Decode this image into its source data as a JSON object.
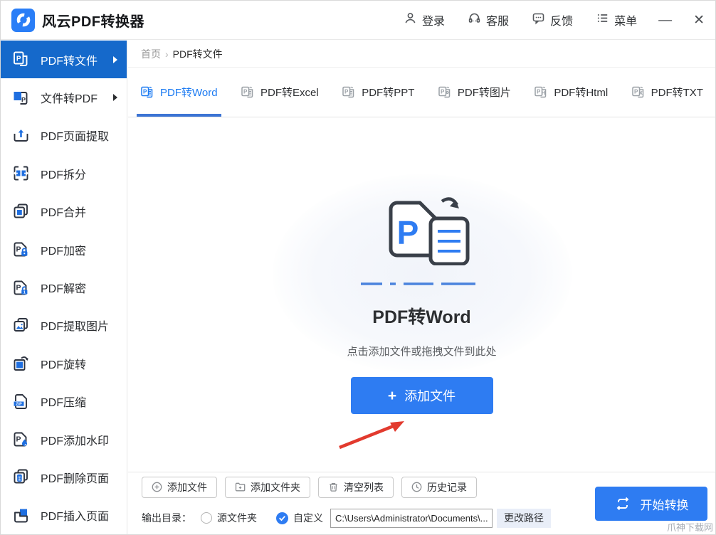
{
  "app": {
    "title": "风云PDF转换器",
    "topbar": {
      "login": "登录",
      "support": "客服",
      "feedback": "反馈",
      "menu": "菜单",
      "minimize": "—",
      "close": "✕"
    }
  },
  "sidebar": {
    "items": [
      {
        "label": "PDF转文件",
        "active": true
      },
      {
        "label": "文件转PDF"
      },
      {
        "label": "PDF页面提取"
      },
      {
        "label": "PDF拆分"
      },
      {
        "label": "PDF合并"
      },
      {
        "label": "PDF加密"
      },
      {
        "label": "PDF解密"
      },
      {
        "label": "PDF提取图片"
      },
      {
        "label": "PDF旋转"
      },
      {
        "label": "PDF压缩"
      },
      {
        "label": "PDF添加水印"
      },
      {
        "label": "PDF删除页面"
      },
      {
        "label": "PDF插入页面"
      }
    ]
  },
  "breadcrumb": {
    "home": "首页",
    "separator": "›",
    "current": "PDF转文件"
  },
  "tabs": [
    {
      "label": "PDF转Word",
      "active": true
    },
    {
      "label": "PDF转Excel"
    },
    {
      "label": "PDF转PPT"
    },
    {
      "label": "PDF转图片"
    },
    {
      "label": "PDF转Html"
    },
    {
      "label": "PDF转TXT"
    }
  ],
  "dropzone": {
    "title": "PDF转Word",
    "hint": "点击添加文件或拖拽文件到此处",
    "add_button_plus": "+",
    "add_button": "添加文件"
  },
  "toolbar": {
    "add_file": "添加文件",
    "add_folder": "添加文件夹",
    "clear_list": "清空列表",
    "history": "历史记录"
  },
  "output": {
    "label": "输出目录：",
    "source_folder": "源文件夹",
    "custom": "自定义",
    "path_value": "C:\\Users\\Administrator\\Documents\\...",
    "change_path": "更改路径",
    "start_convert": "开始转换"
  },
  "watermark": "爪神下载网",
  "icons": {
    "logo-icon": "blue rounded square with white swirl ring",
    "user-icon": "person outline",
    "headset-icon": "customer service headset",
    "feedback-icon": "speech bubble with dots",
    "menu-icon": "list lines",
    "plus-circle-icon": "⊕",
    "folder-plus-icon": "folder with plus",
    "trash-icon": "trash can",
    "clock-icon": "clock",
    "convert-loop-icon": "cyclic arrows",
    "annotation-arrow-icon": "red arrow pointing to add-file button"
  },
  "colors": {
    "primary_blue": "#2e7cf2",
    "sidebar_active_blue": "#1569cb",
    "tab_active_blue": "#1b7af2",
    "arrow_red": "#e23a2e"
  }
}
